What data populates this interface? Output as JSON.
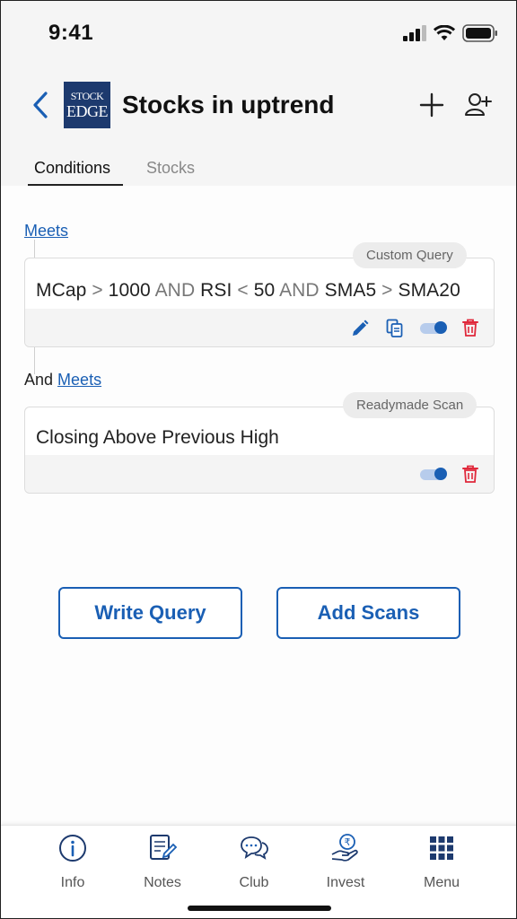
{
  "status_bar": {
    "time": "9:41"
  },
  "header": {
    "title": "Stocks in uptrend",
    "logo_line1": "STOCK",
    "logo_line2": "EDGE"
  },
  "tabs": [
    {
      "label": "Conditions",
      "selected": true
    },
    {
      "label": "Stocks",
      "selected": false
    }
  ],
  "conditions": {
    "meets_label": "Meets",
    "and_label": "And",
    "items": [
      {
        "badge": "Custom Query",
        "query_parts": [
          "MCap",
          ">",
          "1000",
          "AND",
          "RSI",
          "<",
          "50",
          "AND",
          "SMA5",
          ">",
          "SMA20"
        ],
        "enabled": true
      },
      {
        "badge": "Readymade Scan",
        "text": "Closing Above Previous High",
        "enabled": true
      }
    ]
  },
  "actions": {
    "write_query": "Write Query",
    "add_scans": "Add Scans"
  },
  "bottom_nav": [
    {
      "label": "Info",
      "icon": "info-icon"
    },
    {
      "label": "Notes",
      "icon": "notes-icon"
    },
    {
      "label": "Club",
      "icon": "club-icon"
    },
    {
      "label": "Invest",
      "icon": "invest-icon"
    },
    {
      "label": "Menu",
      "icon": "menu-grid-icon"
    }
  ],
  "colors": {
    "accent": "#1a5fb4",
    "delete": "#e0283b",
    "logo_bg": "#1d3a6e"
  }
}
